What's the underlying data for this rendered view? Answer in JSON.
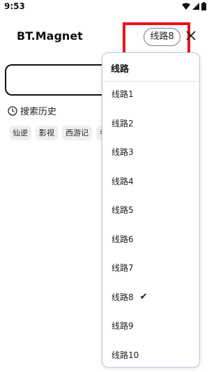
{
  "status_bar": {
    "time": "9:53",
    "icons": [
      "wifi-icon",
      "signal-icon",
      "battery-icon"
    ]
  },
  "app": {
    "title": "BT.Magnet",
    "route_chip_label": "线路8"
  },
  "search": {
    "history_label": "搜索历史",
    "history_chips": [
      "仙逆",
      "影视",
      "西游记",
      "考"
    ]
  },
  "route_menu": {
    "header": "线路",
    "items": [
      {
        "label": "线路1",
        "selected": false
      },
      {
        "label": "线路2",
        "selected": false
      },
      {
        "label": "线路3",
        "selected": false
      },
      {
        "label": "线路4",
        "selected": false
      },
      {
        "label": "线路5",
        "selected": false
      },
      {
        "label": "线路6",
        "selected": false
      },
      {
        "label": "线路7",
        "selected": false
      },
      {
        "label": "线路8",
        "selected": true,
        "check": "✔"
      },
      {
        "label": "线路9",
        "selected": false
      },
      {
        "label": "线路10",
        "selected": false
      }
    ]
  },
  "colors": {
    "highlight_box": "#e8131b",
    "menu_border": "#b9c9e6",
    "chip_bg": "#efefef"
  }
}
